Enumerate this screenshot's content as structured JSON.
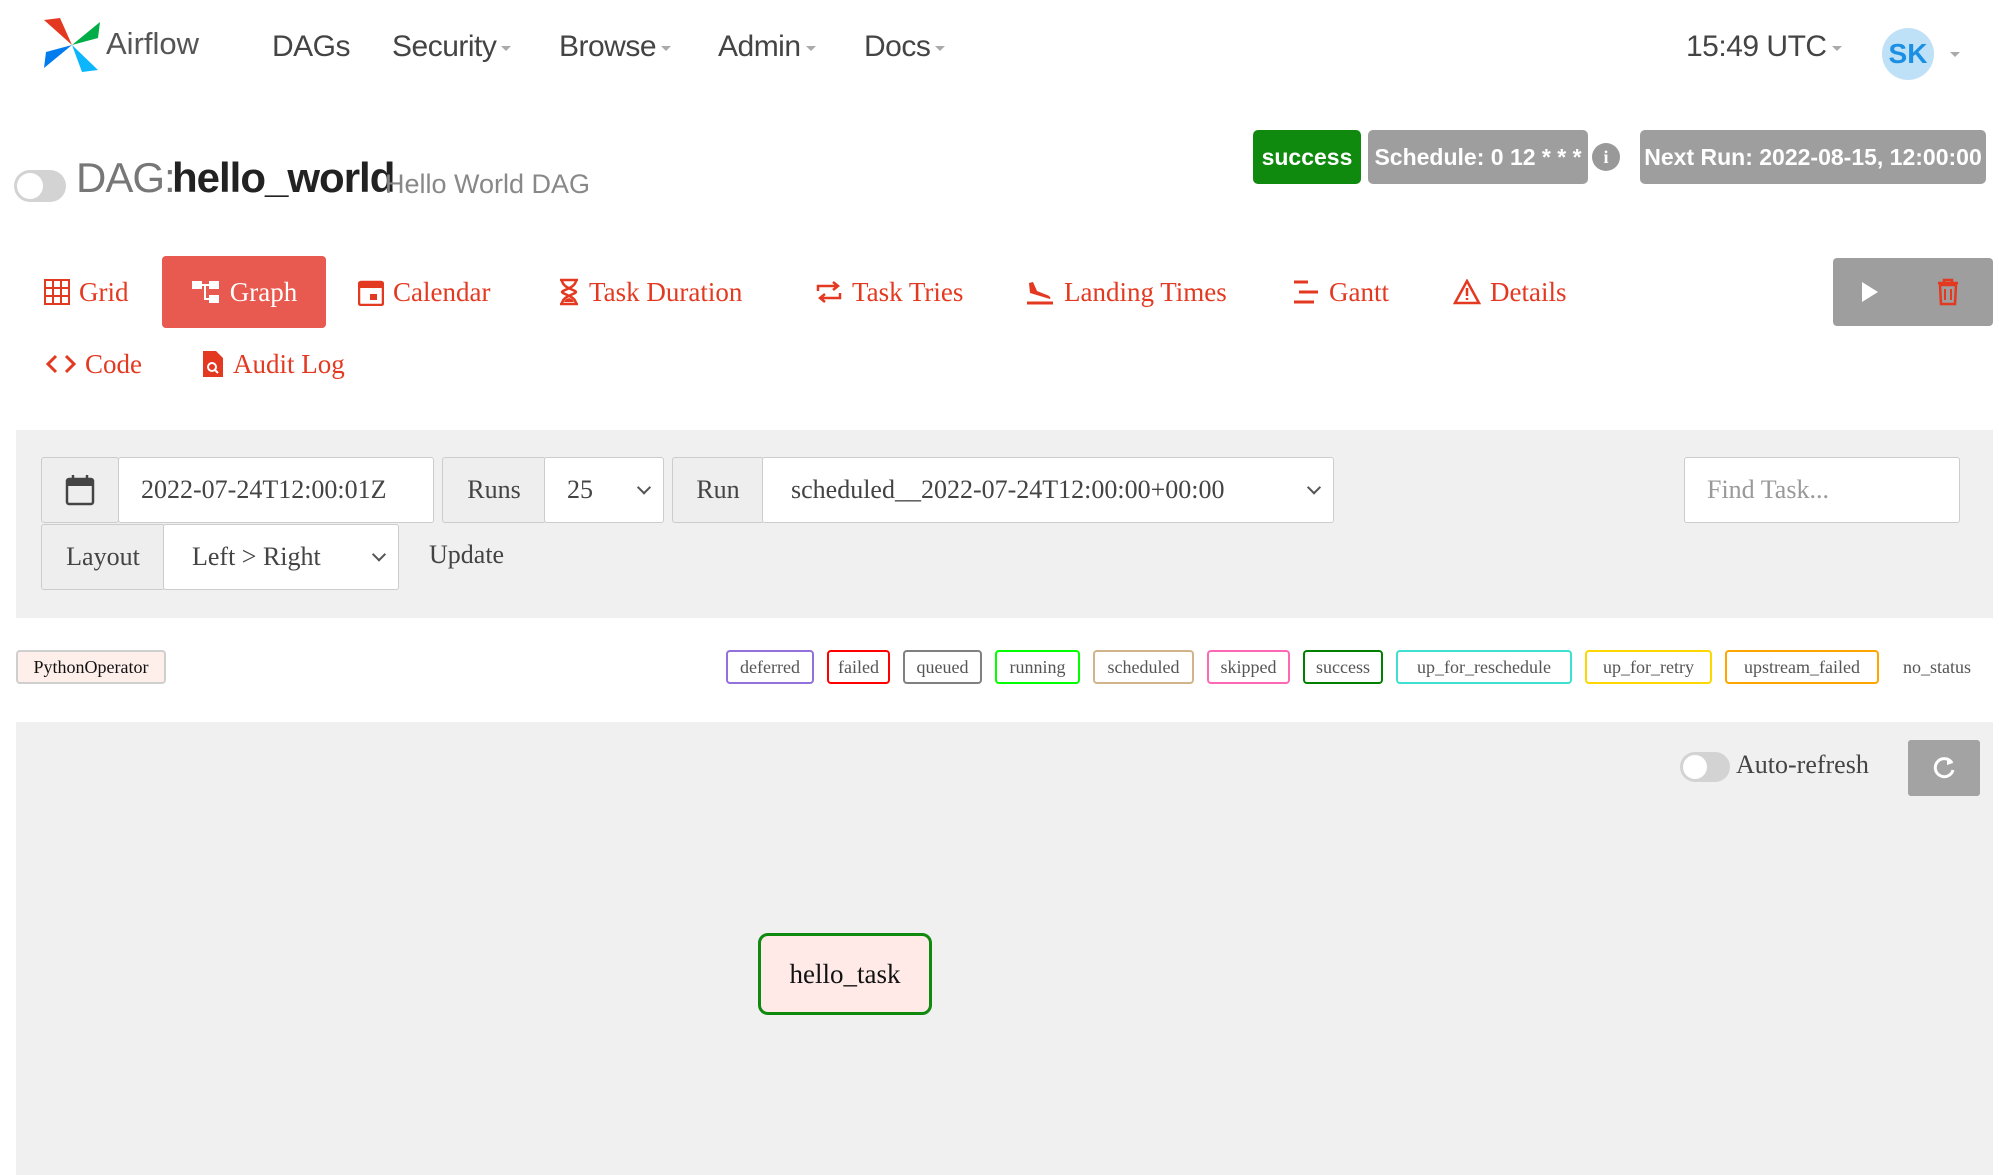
{
  "navbar": {
    "brand": "Airflow",
    "items": [
      {
        "label": "DAGs",
        "dropdown": false
      },
      {
        "label": "Security",
        "dropdown": true
      },
      {
        "label": "Browse",
        "dropdown": true
      },
      {
        "label": "Admin",
        "dropdown": true
      },
      {
        "label": "Docs",
        "dropdown": true
      }
    ],
    "clock": "15:49 UTC",
    "user_initials": "SK"
  },
  "dag": {
    "label": "DAG:",
    "id": "hello_world",
    "description": "Hello World DAG",
    "status": "success",
    "schedule": "Schedule: 0 12 * * *",
    "next_run": "Next Run: 2022-08-15, 12:00:00"
  },
  "tabs": [
    {
      "label": "Grid",
      "icon": "grid-icon"
    },
    {
      "label": "Graph",
      "icon": "graph-icon",
      "active": true
    },
    {
      "label": "Calendar",
      "icon": "calendar-icon"
    },
    {
      "label": "Task Duration",
      "icon": "hourglass-icon"
    },
    {
      "label": "Task Tries",
      "icon": "retry-icon"
    },
    {
      "label": "Landing Times",
      "icon": "landing-icon"
    },
    {
      "label": "Gantt",
      "icon": "gantt-icon"
    },
    {
      "label": "Details",
      "icon": "warning-icon"
    },
    {
      "label": "Code",
      "icon": "code-icon"
    },
    {
      "label": "Audit Log",
      "icon": "audit-log-icon"
    }
  ],
  "filters": {
    "base_date": "2022-07-24T12:00:01Z",
    "runs_label": "Runs",
    "runs_value": "25",
    "run_label": "Run",
    "run_value": "scheduled__2022-07-24T12:00:00+00:00",
    "layout_label": "Layout",
    "layout_value": "Left > Right",
    "update_label": "Update",
    "find_task_placeholder": "Find Task..."
  },
  "operator_legend": {
    "label": "PythonOperator",
    "color": "#ffefeb"
  },
  "status_legend": [
    {
      "label": "deferred",
      "color": "#9370db"
    },
    {
      "label": "failed",
      "color": "#ff0000"
    },
    {
      "label": "queued",
      "color": "#808080"
    },
    {
      "label": "running",
      "color": "#00ff00"
    },
    {
      "label": "scheduled",
      "color": "#d2b48c"
    },
    {
      "label": "skipped",
      "color": "#ff69b4"
    },
    {
      "label": "success",
      "color": "#008000"
    },
    {
      "label": "up_for_reschedule",
      "color": "#40e0d0"
    },
    {
      "label": "up_for_retry",
      "color": "#ffd700"
    },
    {
      "label": "upstream_failed",
      "color": "#ffa500"
    },
    {
      "label": "no_status",
      "color": ""
    }
  ],
  "graph": {
    "auto_refresh_label": "Auto-refresh",
    "task": "hello_task"
  },
  "colors": {
    "accent": "#e8594f",
    "success": "#0f8a0f",
    "gray_button": "#9e9e9e"
  }
}
